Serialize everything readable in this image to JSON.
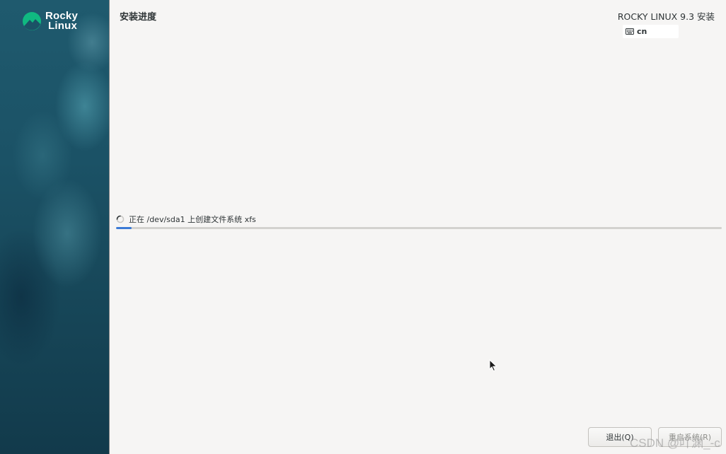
{
  "sidebar": {
    "logo_line1": "Rocky",
    "logo_line2": "Linux",
    "logo_icon": "rocky-linux-logo-icon",
    "background_color": "#1b5266"
  },
  "header": {
    "page_title": "安装进度",
    "product_title": "ROCKY LINUX 9.3 安装",
    "keyboard_icon": "keyboard-icon",
    "keyboard_layout": "cn"
  },
  "progress": {
    "spinner_icon": "spinner-icon",
    "status_text": "正在 /dev/sda1 上创建文件系统 xfs",
    "fraction": 0.026,
    "accent_color": "#3b7ad6"
  },
  "footer": {
    "quit_label": "退出(Q)",
    "reboot_label": "重启系统(R)"
  },
  "watermark": "CSDN @吖渊_-c"
}
